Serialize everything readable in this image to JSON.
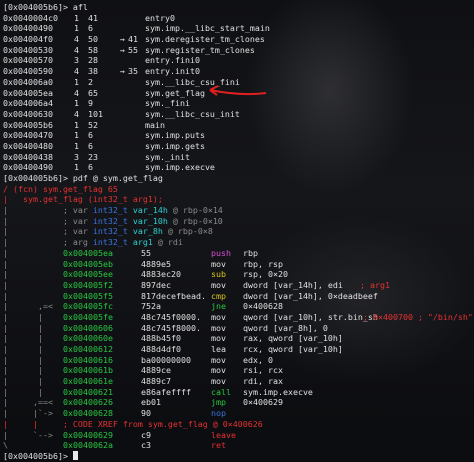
{
  "afl_prompt": "[0x004005b6]> afl",
  "functions": [
    {
      "addr": "0x0040004c0",
      "n": "1",
      "size": "41",
      "xref": "",
      "ref2": "",
      "name": "entry0"
    },
    {
      "addr": "0x00400490",
      "n": "1",
      "size": "6",
      "xref": "",
      "ref2": "",
      "name": "sym.imp.__libc_start_main"
    },
    {
      "addr": "0x004004f0",
      "n": "4",
      "size": "50",
      "xref": "→",
      "ref2": "41",
      "name": "sym.deregister_tm_clones"
    },
    {
      "addr": "0x00400530",
      "n": "4",
      "size": "58",
      "xref": "→",
      "ref2": "55",
      "name": "sym.register_tm_clones"
    },
    {
      "addr": "0x00400570",
      "n": "3",
      "size": "28",
      "xref": "",
      "ref2": "",
      "name": "entry.fini0"
    },
    {
      "addr": "0x00400590",
      "n": "4",
      "size": "38",
      "xref": "→",
      "ref2": "35",
      "name": "entry.init0"
    },
    {
      "addr": "0x004006a0",
      "n": "1",
      "size": "2",
      "xref": "",
      "ref2": "",
      "name": "sym.__libc_csu_fini"
    },
    {
      "addr": "0x004005ea",
      "n": "4",
      "size": "65",
      "xref": "",
      "ref2": "",
      "name": "sym.get_flag"
    },
    {
      "addr": "0x004006a4",
      "n": "1",
      "size": "9",
      "xref": "",
      "ref2": "",
      "name": "sym._fini"
    },
    {
      "addr": "0x00400630",
      "n": "4",
      "size": "101",
      "xref": "",
      "ref2": "",
      "name": "sym.__libc_csu_init"
    },
    {
      "addr": "0x004005b6",
      "n": "1",
      "size": "52",
      "xref": "",
      "ref2": "",
      "name": "main"
    },
    {
      "addr": "0x00400470",
      "n": "1",
      "size": "6",
      "xref": "",
      "ref2": "",
      "name": "sym.imp.puts"
    },
    {
      "addr": "0x00400480",
      "n": "1",
      "size": "6",
      "xref": "",
      "ref2": "",
      "name": "sym.imp.gets"
    },
    {
      "addr": "0x00400438",
      "n": "3",
      "size": "23",
      "xref": "",
      "ref2": "",
      "name": "sym._init"
    },
    {
      "addr": "0x00400490",
      "n": "1",
      "size": "6",
      "xref": "",
      "ref2": "",
      "name": "sym.imp.execve"
    }
  ],
  "pdf_prompt": "[0x004005b6]> pdf @ sym.get_flag",
  "fcn_header": "/ (fcn) sym.get_flag 65",
  "signature": "|   sym.get_flag (int32_t arg1);",
  "vars": [
    {
      "prefix": "|           ; var ",
      "type": "int32_t",
      "name": "var_14h",
      "loc": "@ rbp-0×14"
    },
    {
      "prefix": "|           ; var ",
      "type": "int32_t",
      "name": "var_10h",
      "loc": "@ rbp-0×10"
    },
    {
      "prefix": "|           ; var ",
      "type": "int32_t",
      "name": "var_8h",
      "loc": "@ rbp-0×8"
    },
    {
      "prefix": "|           ; arg ",
      "type": "int32_t",
      "name": "arg1",
      "loc": "@ rdi"
    }
  ],
  "disasm": [
    {
      "gut": "|           ",
      "addr": "0x004005ea",
      "bytes": "55",
      "mn": "push",
      "ops": "rbp",
      "cls": "m",
      "cmt": ""
    },
    {
      "gut": "|           ",
      "addr": "0x004005eb",
      "bytes": "4889e5",
      "mn": "mov",
      "ops": "rbp, rsp",
      "cls": "w",
      "cmt": ""
    },
    {
      "gut": "|           ",
      "addr": "0x004005ee",
      "bytes": "4883ec20",
      "mn": "sub",
      "ops": "rsp, 0×20",
      "cls": "y",
      "cmt": ""
    },
    {
      "gut": "|           ",
      "addr": "0x004005f2",
      "bytes": "897dec",
      "mn": "mov",
      "ops": "dword [var_14h], edi",
      "cls": "w",
      "cmt": "; arg1"
    },
    {
      "gut": "|           ",
      "addr": "0x004005f5",
      "bytes": "817decefbead.",
      "mn": "cmp",
      "ops": "dword [var_14h], 0×deadbeef",
      "cls": "y",
      "cmt": ""
    },
    {
      "gut": "|      ,=<  ",
      "addr": "0x004005fc",
      "bytes": "752a",
      "mn": "jne",
      "ops": "0×400628",
      "cls": "g",
      "cmt": ""
    },
    {
      "gut": "|      |    ",
      "addr": "0x004005fe",
      "bytes": "48c745f0000.",
      "mn": "mov",
      "ops": "qword [var_10h], str.bin_sh",
      "cls": "w",
      "cmt": "; 0×400700 ; \"/bin/sh\""
    },
    {
      "gut": "|      |    ",
      "addr": "0x00400606",
      "bytes": "48c745f8000.",
      "mn": "mov",
      "ops": "qword [var_8h], 0",
      "cls": "w",
      "cmt": ""
    },
    {
      "gut": "|      |    ",
      "addr": "0x0040060e",
      "bytes": "488b45f0",
      "mn": "mov",
      "ops": "rax, qword [var_10h]",
      "cls": "w",
      "cmt": ""
    },
    {
      "gut": "|      |    ",
      "addr": "0x00400612",
      "bytes": "488d4df0",
      "mn": "lea",
      "ops": "rcx, qword [var_10h]",
      "cls": "w",
      "cmt": ""
    },
    {
      "gut": "|      |    ",
      "addr": "0x00400616",
      "bytes": "ba00000000",
      "mn": "mov",
      "ops": "edx, 0",
      "cls": "w",
      "cmt": ""
    },
    {
      "gut": "|      |    ",
      "addr": "0x0040061b",
      "bytes": "4889ce",
      "mn": "mov",
      "ops": "rsi, rcx",
      "cls": "w",
      "cmt": ""
    },
    {
      "gut": "|      |    ",
      "addr": "0x0040061e",
      "bytes": "4889c7",
      "mn": "mov",
      "ops": "rdi, rax",
      "cls": "w",
      "cmt": ""
    },
    {
      "gut": "|      |    ",
      "addr": "0x00400621",
      "bytes": "e86afeffff",
      "mn": "call",
      "ops": "sym.imp.execve",
      "cls": "g",
      "cmt": ""
    },
    {
      "gut": "|     ,==<  ",
      "addr": "0x00400626",
      "bytes": "eb01",
      "mn": "jmp",
      "ops": "0×400629",
      "cls": "g",
      "cmt": ""
    },
    {
      "gut": "|     |`->  ",
      "addr": "0x00400628",
      "bytes": "90",
      "mn": "nop",
      "ops": "",
      "cls": "b",
      "cmt": ""
    }
  ],
  "xref": "|     |     ; CODE XREF from sym.get_flag @ 0×400626",
  "disasm_tail": [
    {
      "gut": "|     `-->  ",
      "addr": "0x00400629",
      "bytes": "c9",
      "mn": "leave",
      "ops": "",
      "cls": "r",
      "cmt": ""
    },
    {
      "gut": "\\           ",
      "addr": "0x0040062a",
      "bytes": "c3",
      "mn": "ret",
      "ops": "",
      "cls": "r",
      "cmt": ""
    }
  ],
  "final_prompt": "[0x004005b6]> "
}
